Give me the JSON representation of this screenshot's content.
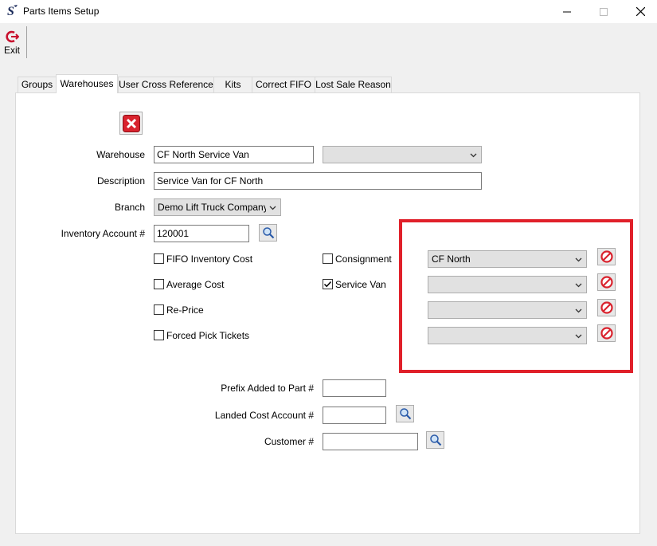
{
  "window": {
    "title": "Parts Items Setup"
  },
  "toolbar": {
    "exit_label": "Exit"
  },
  "tabs": [
    {
      "label": "Groups",
      "active": false
    },
    {
      "label": "Warehouses",
      "active": true
    },
    {
      "label": "User Cross Reference",
      "active": false
    },
    {
      "label": "Kits",
      "active": false
    },
    {
      "label": "Correct FIFO",
      "active": false
    },
    {
      "label": "Lost Sale Reason",
      "active": false
    }
  ],
  "form": {
    "warehouse": {
      "label": "Warehouse",
      "value": "CF North Service Van",
      "combo_value": ""
    },
    "description": {
      "label": "Description",
      "value": "Service Van for CF North"
    },
    "branch": {
      "label": "Branch",
      "value": "Demo Lift Truck Company"
    },
    "inventory_account": {
      "label": "Inventory Account #",
      "value": "120001"
    },
    "checkboxes": {
      "fifo_inventory_cost": {
        "label": "FIFO Inventory Cost",
        "checked": false
      },
      "average_cost": {
        "label": "Average Cost",
        "checked": false
      },
      "re_price": {
        "label": "Re-Price",
        "checked": false
      },
      "forced_pick_tickets": {
        "label": "Forced Pick Tickets",
        "checked": false
      },
      "consignment": {
        "label": "Consignment",
        "checked": false
      },
      "service_van": {
        "label": "Service Van",
        "checked": true
      }
    },
    "assignments": [
      {
        "value": "CF North"
      },
      {
        "value": ""
      },
      {
        "value": ""
      },
      {
        "value": ""
      }
    ],
    "prefix_added": {
      "label": "Prefix Added to Part #",
      "value": ""
    },
    "landed_cost_account": {
      "label": "Landed Cost Account #",
      "value": ""
    },
    "customer": {
      "label": "Customer #",
      "value": ""
    }
  },
  "colors": {
    "highlight": "#e0202a",
    "delete_red": "#d9232e"
  }
}
